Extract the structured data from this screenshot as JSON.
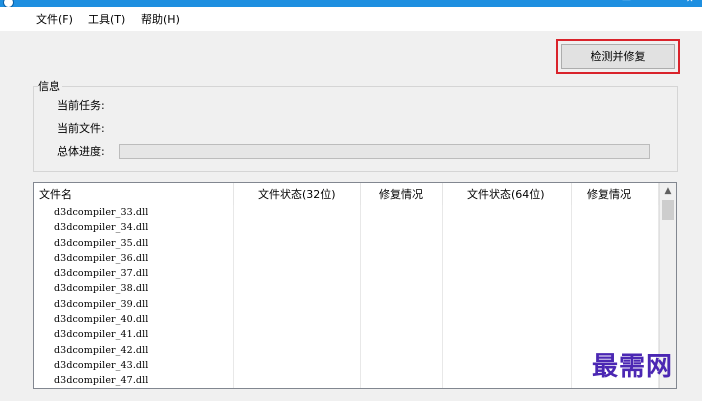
{
  "window": {
    "title": "",
    "controls": [
      "—",
      "✕"
    ]
  },
  "menu": [
    "文件(F)",
    "工具(T)",
    "帮助(H)"
  ],
  "actions": {
    "fix_button": "检测并修复"
  },
  "info": {
    "group_label": "信息",
    "current_task_label": "当前任务:",
    "current_file_label": "当前文件:",
    "overall_progress_label": "总体进度:",
    "overall_progress": 0
  },
  "table": {
    "columns": [
      "文件名",
      "文件状态(32位)",
      "修复情况",
      "文件状态(64位)",
      "修复情况"
    ],
    "rows": [
      "d3dcompiler_33.dll",
      "d3dcompiler_34.dll",
      "d3dcompiler_35.dll",
      "d3dcompiler_36.dll",
      "d3dcompiler_37.dll",
      "d3dcompiler_38.dll",
      "d3dcompiler_39.dll",
      "d3dcompiler_40.dll",
      "d3dcompiler_41.dll",
      "d3dcompiler_42.dll",
      "d3dcompiler_43.dll",
      "d3dcompiler_47.dll"
    ]
  },
  "watermark": "最需网",
  "colors": {
    "titlebar": "#1e8fe0",
    "highlight_border": "#d9232b",
    "watermark": "#4b27b3"
  }
}
